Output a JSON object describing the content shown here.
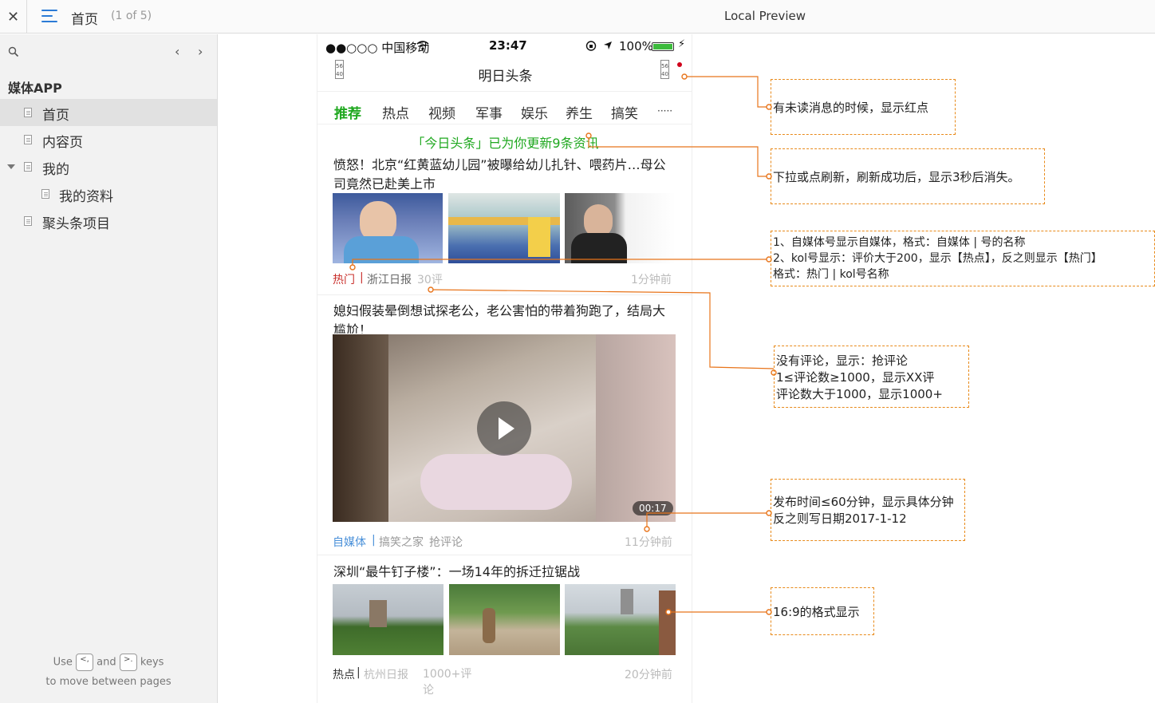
{
  "topbar": {
    "close_icon": "✕",
    "title": "首页",
    "count": "(1 of 5)",
    "preview_label": "Local Preview"
  },
  "sidebar": {
    "prev_icon": "‹",
    "next_icon": "›",
    "root_label": "媒体APP",
    "items": [
      {
        "label": "首页"
      },
      {
        "label": "内容页"
      },
      {
        "label": "我的"
      },
      {
        "label": "我的资料"
      },
      {
        "label": "聚头条项目"
      }
    ],
    "help": {
      "use": "Use",
      "and": "and",
      "keys": "keys",
      "line2": "to move between pages",
      "key_left": "<,",
      "key_right": ">."
    }
  },
  "phone": {
    "status": {
      "carrier": "●●○○○ 中国移动",
      "time": "23:47",
      "battery_pct": "100%"
    },
    "nav_title": "明日头条",
    "tabs": [
      "推荐",
      "热点",
      "视频",
      "军事",
      "娱乐",
      "养生",
      "搞笑",
      "·····"
    ],
    "refresh_text": "「今日头条」已为你更新9条资讯",
    "articles": [
      {
        "title": "愤怒！北京“红黄蓝幼儿园”被曝给幼儿扎针、喂药片…母公司竟然已赴美上市",
        "tag": "热门",
        "divider": "|",
        "source": "浙江日报",
        "comments": "30评",
        "time": "1分钟前"
      },
      {
        "title": "媳妇假装晕倒想试探老公，老公害怕的带着狗跑了，结局大尴尬！",
        "duration": "00:17",
        "tag": "自媒体",
        "divider": "|",
        "source": "搞笑之家",
        "comments": "抢评论",
        "time": "11分钟前"
      },
      {
        "title": "深圳“最牛钉子楼”：一场14年的拆迁拉锯战",
        "tag": "热点",
        "divider": "|",
        "source": "杭州日报",
        "comments": "1000+评论",
        "time": "20分钟前"
      }
    ]
  },
  "annotations": [
    {
      "lines": [
        "有未读消息的时候，显示红点"
      ]
    },
    {
      "lines": [
        "下拉或点刷新，刷新成功后，显示3秒后消失。"
      ]
    },
    {
      "lines": [
        "1、自媒体号显示自媒体，格式：自媒体 | 号的名称",
        "2、kol号显示：评价大于200，显示【热点】，反之则显示【热门】",
        "格式：热门 | kol号名称"
      ]
    },
    {
      "lines": [
        "没有评论，显示：抢评论",
        "1≤评论数≥1000，显示XX评",
        "评论数大于1000，显示1000+"
      ]
    },
    {
      "lines": [
        "发布时间≤60分钟，显示具体分钟",
        "反之则写日期2017-1-12"
      ]
    },
    {
      "lines": [
        "16:9的格式显示"
      ]
    }
  ],
  "colors": {
    "accent_green": "#1fa81f",
    "annotation_orange": "#e8741a",
    "hot_red": "#c9302c",
    "media_blue": "#4a90d9",
    "menu_blue": "#2b7bd6"
  }
}
